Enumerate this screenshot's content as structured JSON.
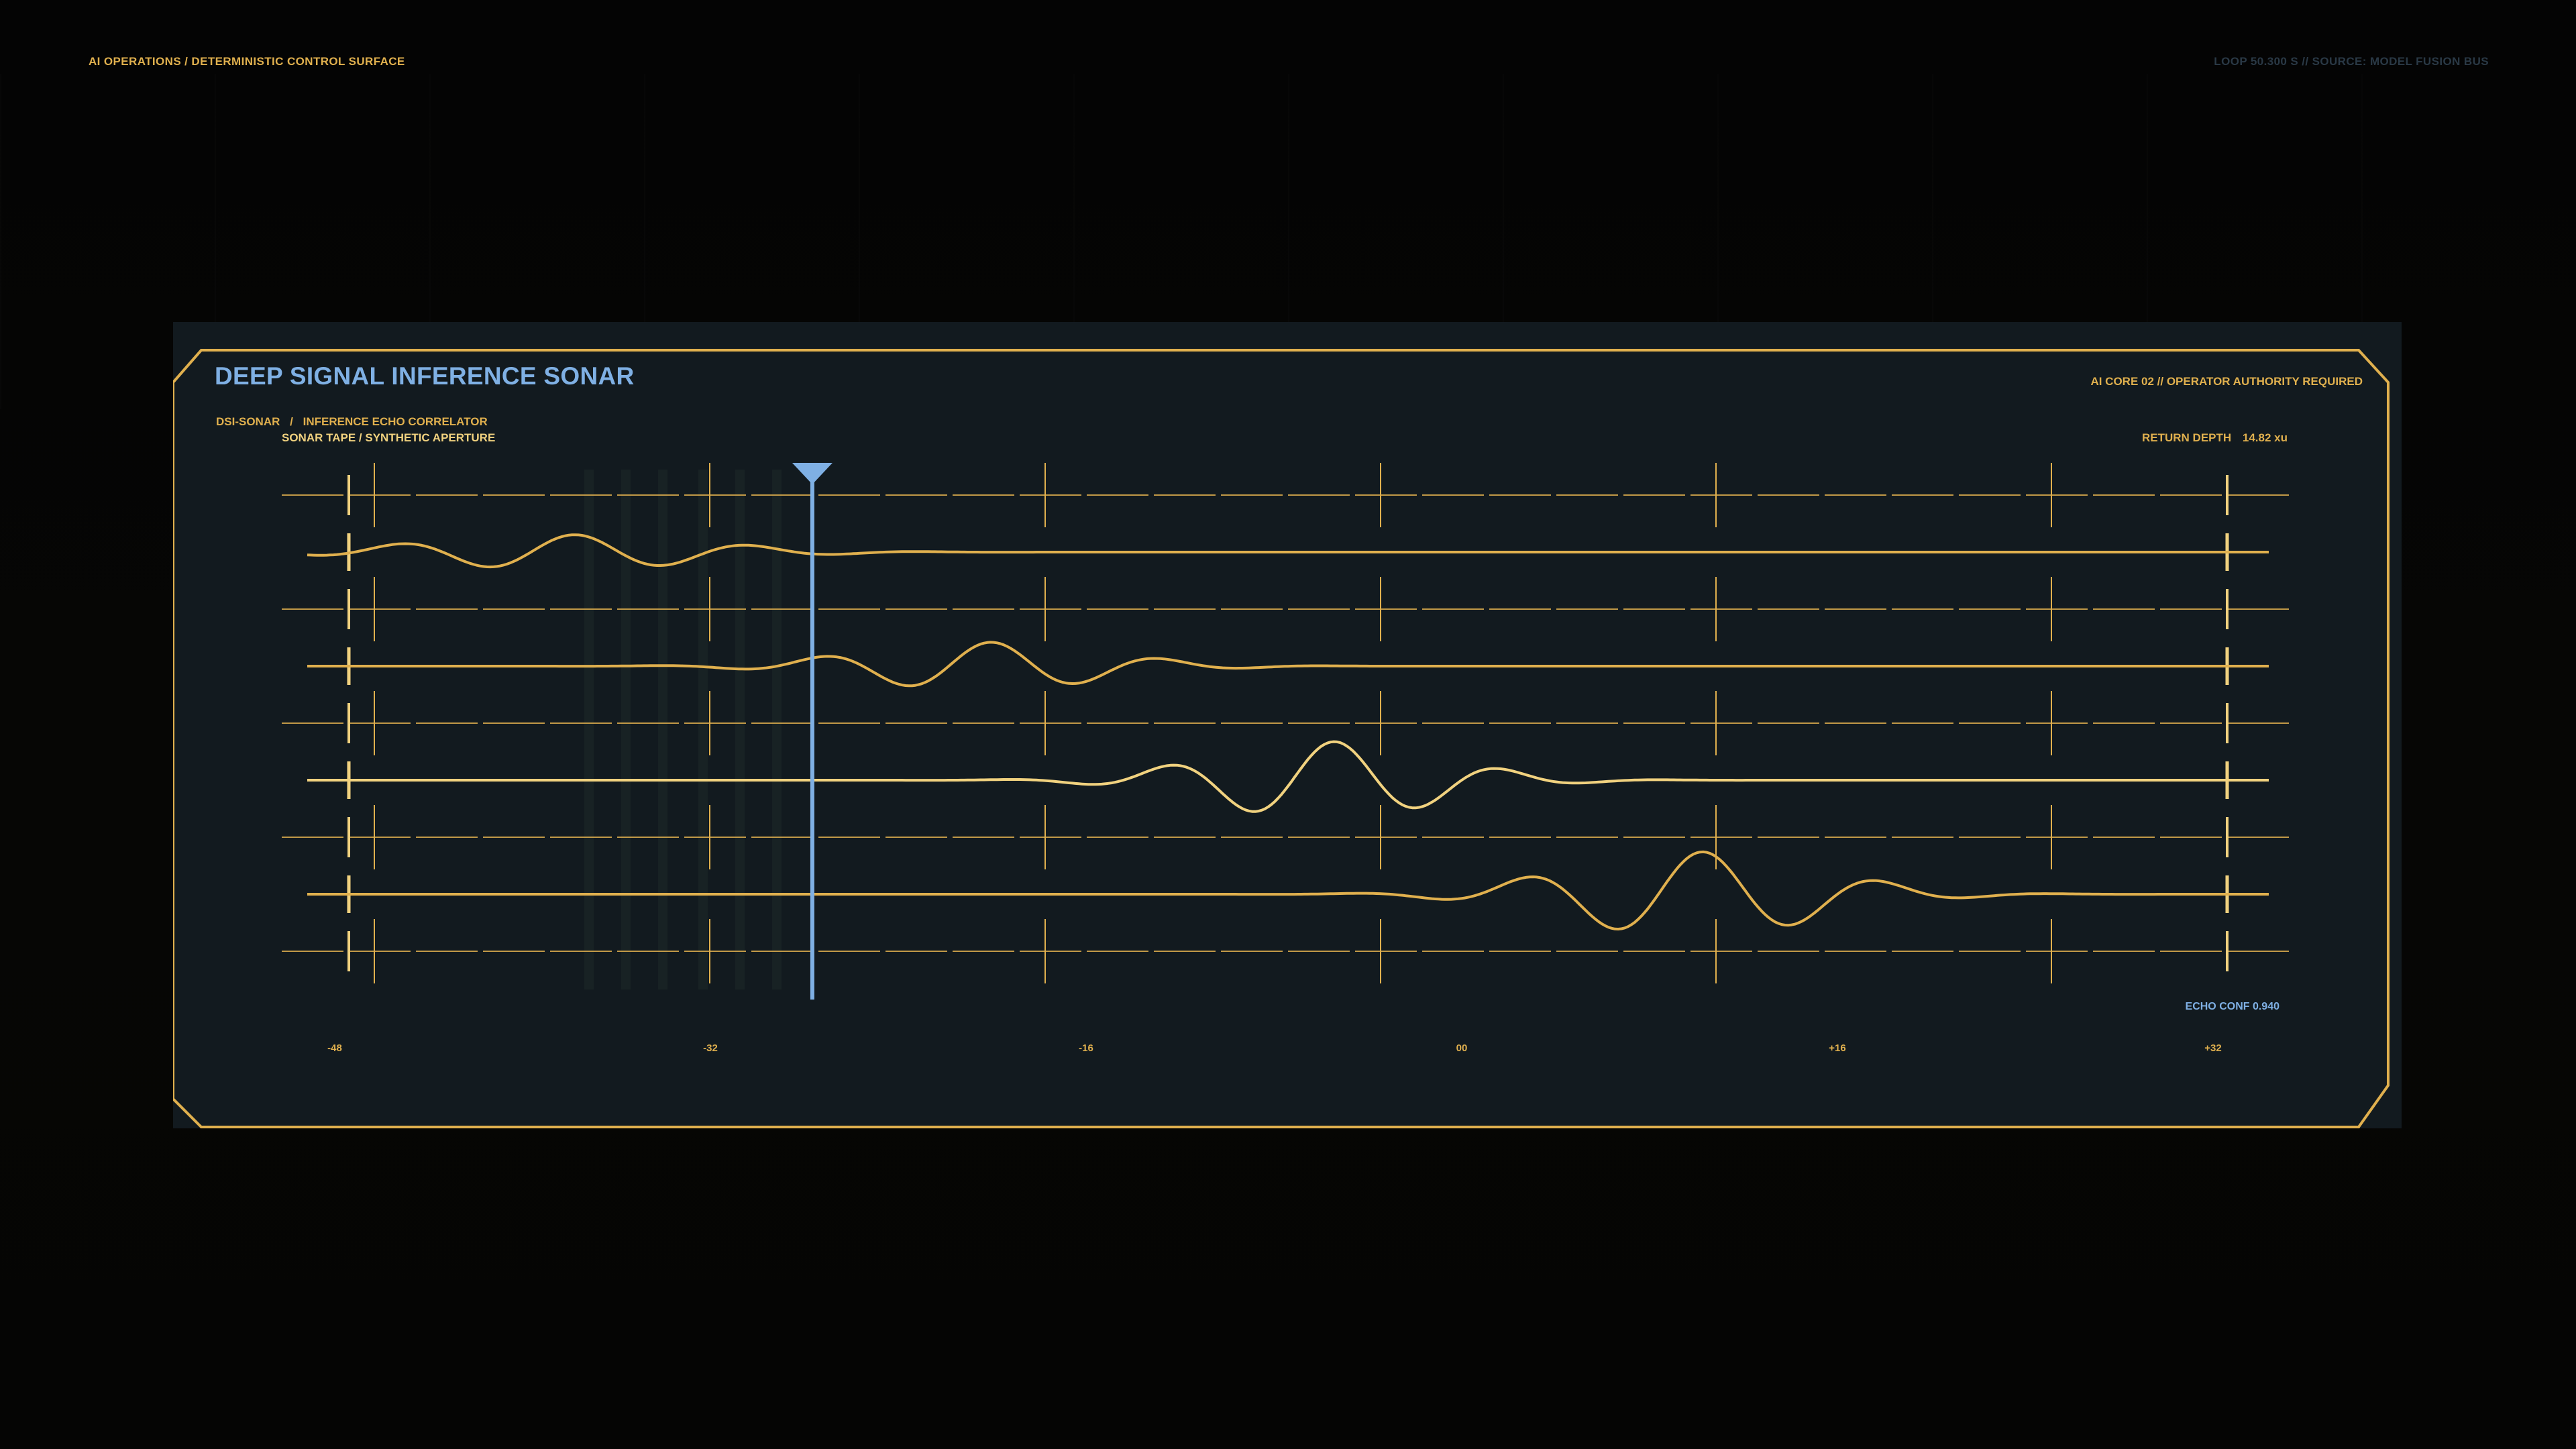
{
  "colors": {
    "accent": "#e0b04e",
    "accent_bright": "#f1d27f",
    "cursor": "#7fb0e4",
    "panel_bg": "#121a1f",
    "page_bg": "#050505",
    "dim_text": "#2a3946"
  },
  "header": {
    "left": "AI OPERATIONS / DETERMINISTIC CONTROL SURFACE",
    "right": "LOOP 50.300 S  //  SOURCE: MODEL FUSION BUS"
  },
  "panel": {
    "title": "DEEP SIGNAL INFERENCE SONAR",
    "authority": "AI CORE 02 // OPERATOR AUTHORITY REQUIRED",
    "subtitle_a": "DSI-SONAR",
    "subtitle_sep": "/",
    "subtitle_b": "INFERENCE ECHO CORRELATOR",
    "subtitle_2": "SONAR TAPE / SYNTHETIC APERTURE",
    "depth_label": "RETURN DEPTH",
    "depth_value": "14.82 xu",
    "echo_conf": "ECHO CONF 0.940"
  },
  "chart_data": {
    "type": "line",
    "x_ticks": [
      "-48",
      "-32",
      "-16",
      "00",
      "+16",
      "+32"
    ],
    "xlim": [
      -48,
      32
    ],
    "cursor_x": -27.4,
    "trace_count": 4,
    "traces": [
      {
        "echoes": [
          {
            "center": -37.5,
            "amp": 0.45,
            "sigma": 5.5,
            "period": 7.2
          }
        ]
      },
      {
        "echoes": [
          {
            "center": -20.5,
            "amp": 0.62,
            "sigma": 4.8,
            "period": 7.0
          }
        ]
      },
      {
        "echoes": [
          {
            "center": -6.5,
            "amp": 1.0,
            "sigma": 4.6,
            "period": 6.9
          }
        ]
      },
      {
        "echoes": [
          {
            "center": 8.5,
            "amp": 1.1,
            "sigma": 5.0,
            "period": 7.3
          }
        ]
      }
    ]
  }
}
